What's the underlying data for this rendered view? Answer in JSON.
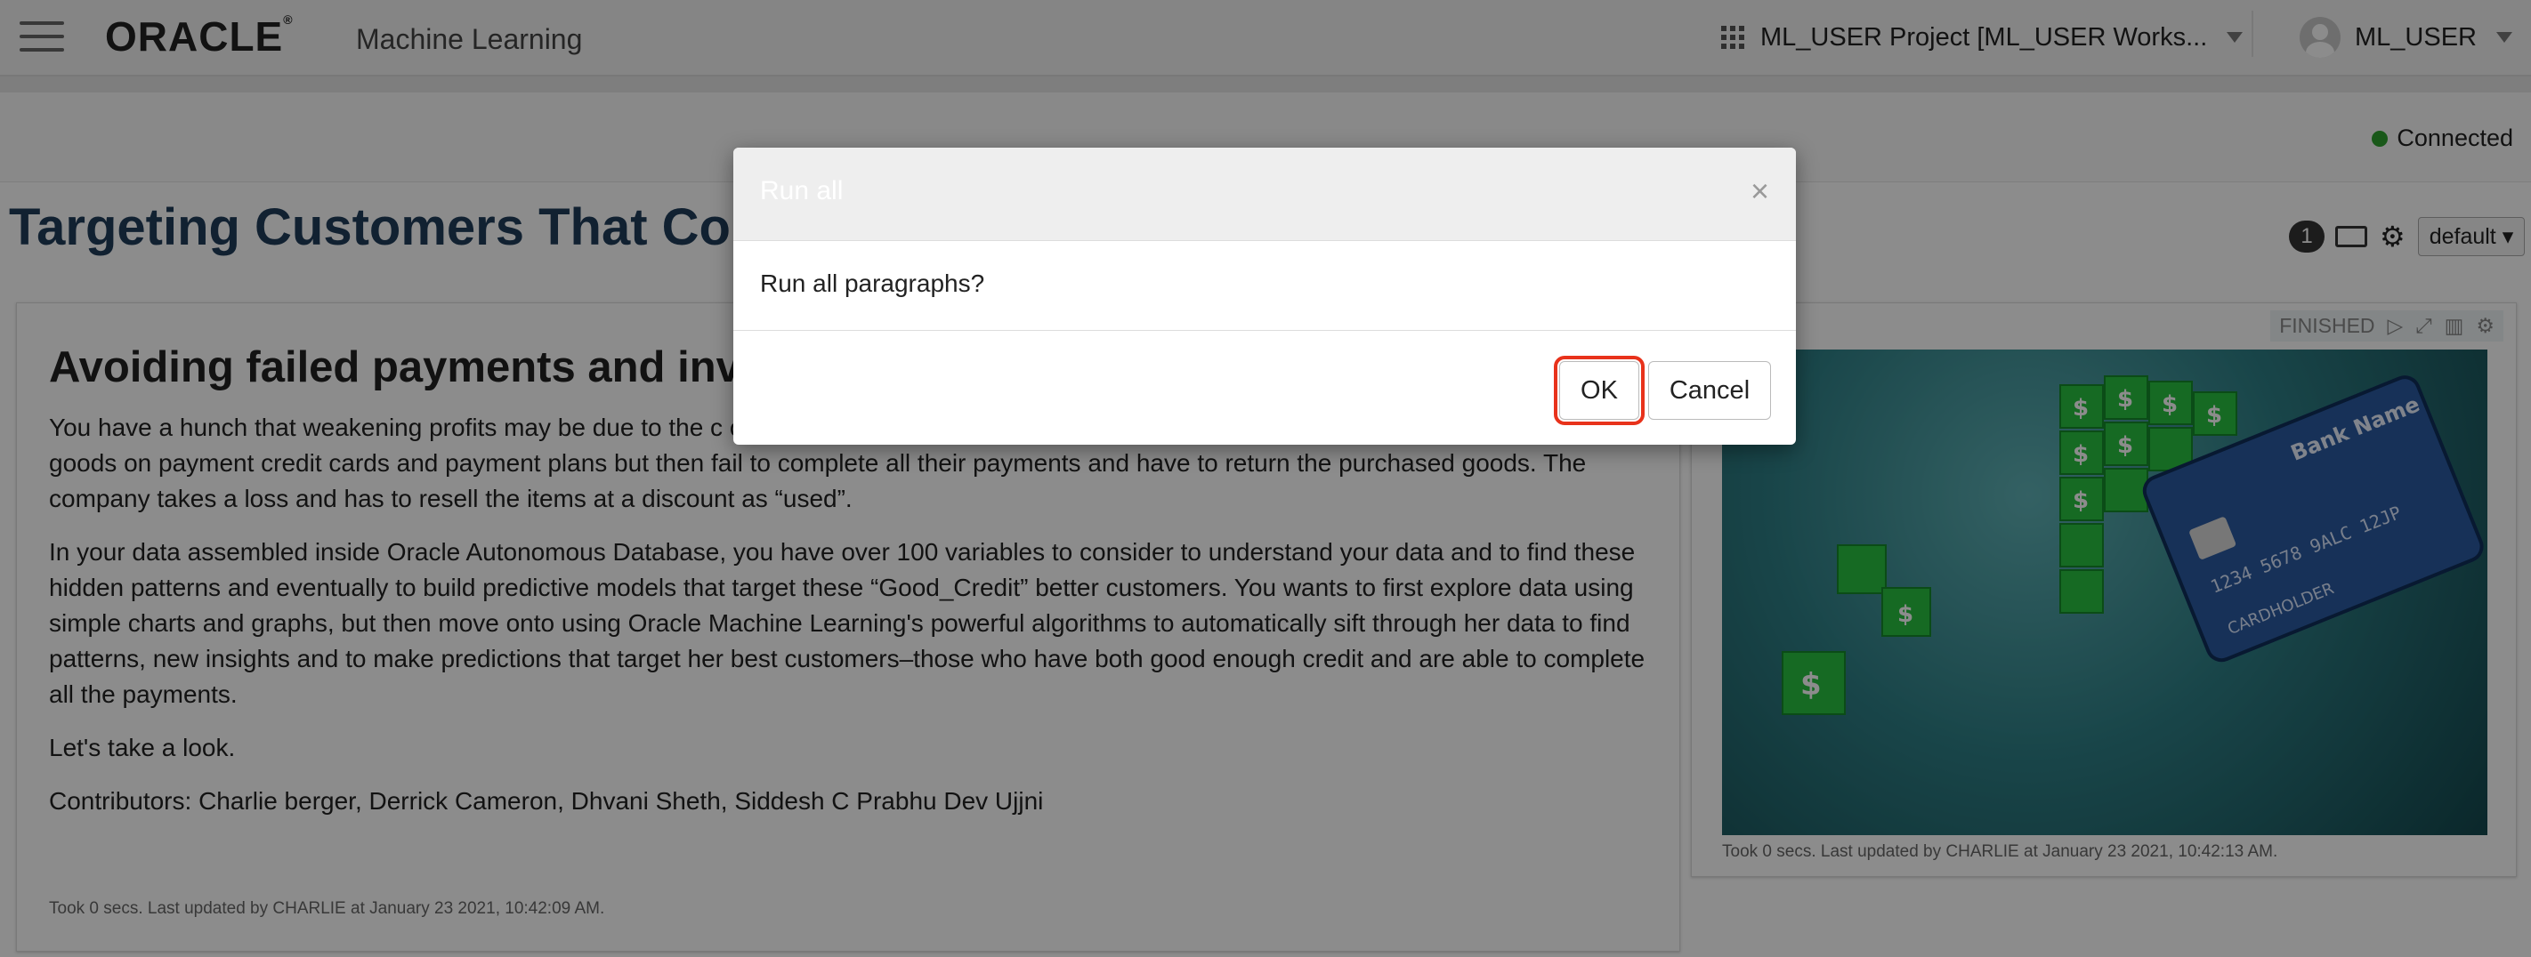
{
  "header": {
    "brand": "ORACLE",
    "product": "Machine Learning",
    "project": "ML_USER Project [ML_USER Works...",
    "user": "ML_USER"
  },
  "status": {
    "connection": "Connected"
  },
  "notebook": {
    "title": "Targeting Customers That Comp",
    "badge_count": "1",
    "interpreter": "default"
  },
  "paragraph_text": {
    "heading": "Avoiding failed payments and invol",
    "body": [
      "You have a hunch that weakening profits may be due to the c credit to purchase “big ticket items” e.g. large televisions, appliances and durable goods on payment credit cards and payment plans but then fail to complete all their payments and have to return the purchased goods. The company takes a loss and has to resell the items at a discount as “used”.",
      "In your data assembled inside Oracle Autonomous Database, you have over 100 variables to consider to understand your data and to find these hidden patterns and eventually to build predictive models that target these “Good_Credit” better customers. You wants to first explore data using simple charts and graphs, but then move onto using Oracle Machine Learning's powerful algorithms to automatically sift through her data to find patterns, new insights and to make predictions that target her best customers–those who have both good enough credit and are able to complete all the payments.",
      "Let's take a look.",
      "Contributors: Charlie berger, Derrick Cameron, Dhvani Sheth, Siddesh C Prabhu Dev Ujjni"
    ],
    "footer": "Took 0 secs. Last updated by CHARLIE at January 23 2021, 10:42:09 AM."
  },
  "paragraph_image": {
    "status": "FINISHED",
    "card_bank": "Bank Name",
    "card_number": "1234 5678 9ALC 12JP",
    "card_holder": "CARDHOLDER",
    "footer": "Took 0 secs. Last updated by CHARLIE at January 23 2021, 10:42:13 AM."
  },
  "modal": {
    "title": "Run all",
    "close": "×",
    "message": "Run all paragraphs?",
    "ok_label": "OK",
    "cancel_label": "Cancel"
  },
  "colors": {
    "accent_highlight": "#e8321b",
    "connected_dot": "#2fa02f",
    "title_blue": "#1f3c5a"
  }
}
